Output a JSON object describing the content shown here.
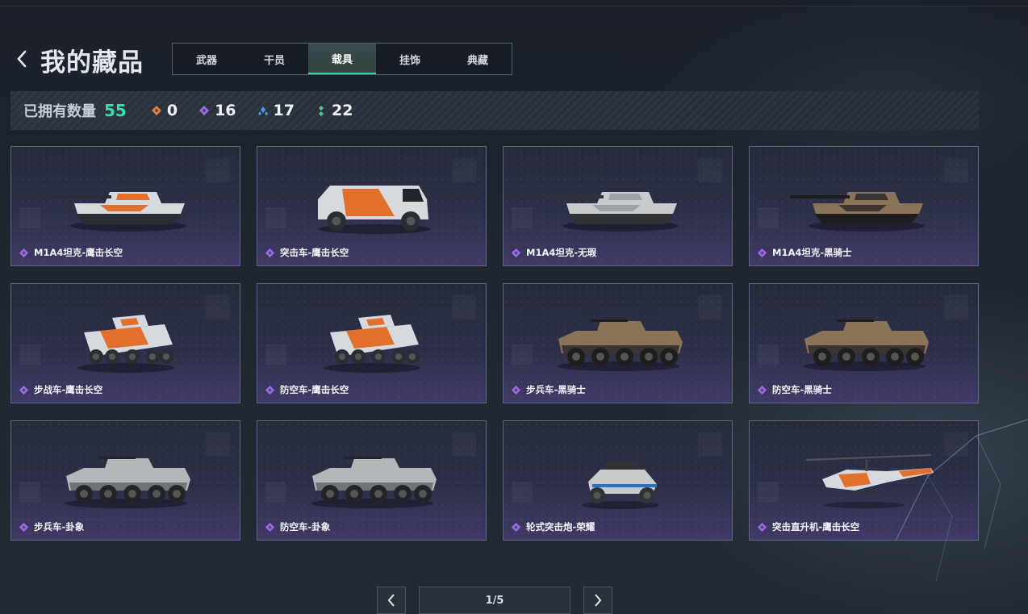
{
  "header": {
    "title": "我的藏品",
    "tabs": [
      {
        "label": "武器",
        "active": false
      },
      {
        "label": "干员",
        "active": false
      },
      {
        "label": "载具",
        "active": true
      },
      {
        "label": "挂饰",
        "active": false
      },
      {
        "label": "典藏",
        "active": false
      }
    ]
  },
  "stats": {
    "label": "已拥有数量",
    "total": "55",
    "rarities": [
      {
        "icon": "orange-diamond-icon",
        "color": "#e0834a",
        "count": "0"
      },
      {
        "icon": "purple-diamond-icon",
        "color": "#9b6ee0",
        "count": "16"
      },
      {
        "icon": "blue-diamond-icon",
        "color": "#4a9ce8",
        "count": "17"
      },
      {
        "icon": "green-diamond-icon",
        "color": "#3ad49a",
        "count": "22"
      }
    ]
  },
  "items": [
    {
      "name": "M1A4坦克-鹰击长空",
      "vehicle": "tank",
      "skin": "orange"
    },
    {
      "name": "突击车-鹰击长空",
      "vehicle": "truck",
      "skin": "orange"
    },
    {
      "name": "M1A4坦克-无瑕",
      "vehicle": "tank",
      "skin": "white"
    },
    {
      "name": "M1A4坦克-黑骑士",
      "vehicle": "tank",
      "skin": "dark"
    },
    {
      "name": "步战车-鹰击长空",
      "vehicle": "ifv",
      "skin": "orange"
    },
    {
      "name": "防空车-鹰击长空",
      "vehicle": "ifv",
      "skin": "orange"
    },
    {
      "name": "步兵车-黑骑士",
      "vehicle": "apc",
      "skin": "dark"
    },
    {
      "name": "防空车-黑骑士",
      "vehicle": "apc",
      "skin": "dark"
    },
    {
      "name": "步兵车-卦象",
      "vehicle": "apc",
      "skin": "grey"
    },
    {
      "name": "防空车-卦象",
      "vehicle": "apc",
      "skin": "grey"
    },
    {
      "name": "轮式突击炮-荣耀",
      "vehicle": "buggy",
      "skin": "white"
    },
    {
      "name": "突击直升机-鹰击长空",
      "vehicle": "heli",
      "skin": "orange"
    }
  ],
  "pagination": {
    "label": "1/5"
  },
  "colors": {
    "accent": "#34d6a3",
    "rarity_purple": "#9b6ee0"
  }
}
